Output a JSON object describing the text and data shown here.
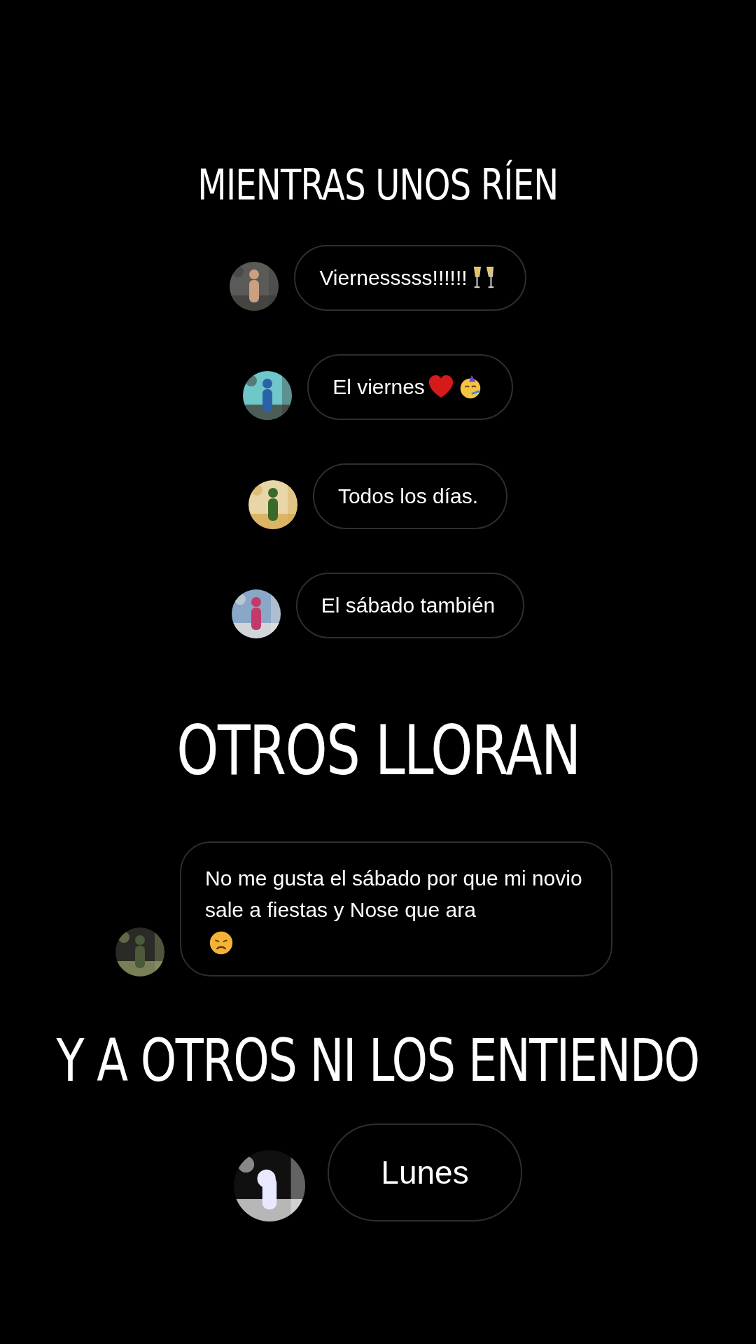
{
  "sections": [
    {
      "heading": "MIENTRAS UNOS RÍEN",
      "kind": "small",
      "replies": [
        {
          "text": "Viernesssss!!!!!!",
          "emoji": [
            {
              "kind": "champagne"
            }
          ],
          "kind": "pill"
        },
        {
          "text": "El viernes",
          "emoji": [
            {
              "kind": "heart"
            },
            {
              "kind": "party"
            }
          ],
          "kind": "pill"
        },
        {
          "text": "Todos los días.",
          "kind": "pill"
        },
        {
          "text": "El sábado también",
          "kind": "pill"
        }
      ]
    },
    {
      "heading": "OTROS LLORAN",
      "kind": "large",
      "replies": [
        {
          "text": "No me gusta el sábado por que mi novio sale a fiestas y Nose que ara",
          "emoji": [
            {
              "kind": "sad"
            }
          ],
          "kind": "box"
        }
      ]
    },
    {
      "heading": "Y A OTROS NI LOS ENTIENDO",
      "kind": "medium",
      "replies": [
        {
          "text": "Lunes",
          "kind": "big"
        }
      ]
    }
  ]
}
